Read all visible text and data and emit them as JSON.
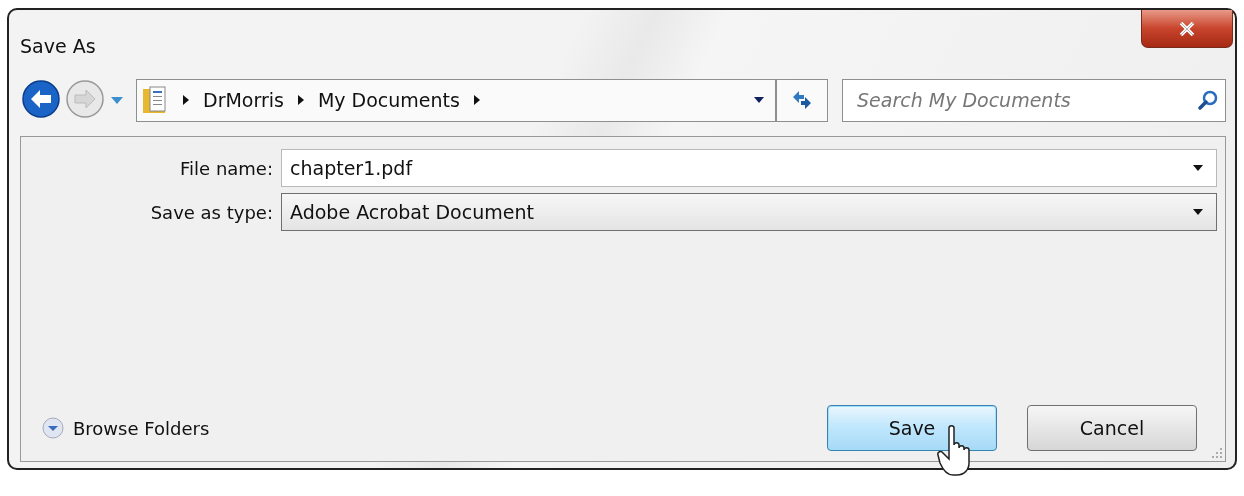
{
  "window": {
    "title": "Save As"
  },
  "navigation": {
    "back_enabled": true,
    "forward_enabled": false
  },
  "address": {
    "segments": [
      "DrMorris",
      "My Documents"
    ]
  },
  "search": {
    "placeholder": "Search My Documents"
  },
  "fields": [
    {
      "label": "File name:",
      "value": "chapter1.pdf",
      "kind": "combo"
    },
    {
      "label": "Save as type:",
      "value": "Adobe Acrobat Document",
      "kind": "dropdown"
    }
  ],
  "browse_folders": {
    "label": "Browse Folders"
  },
  "buttons": [
    {
      "label": "Save",
      "default": true
    },
    {
      "label": "Cancel",
      "default": false
    }
  ]
}
